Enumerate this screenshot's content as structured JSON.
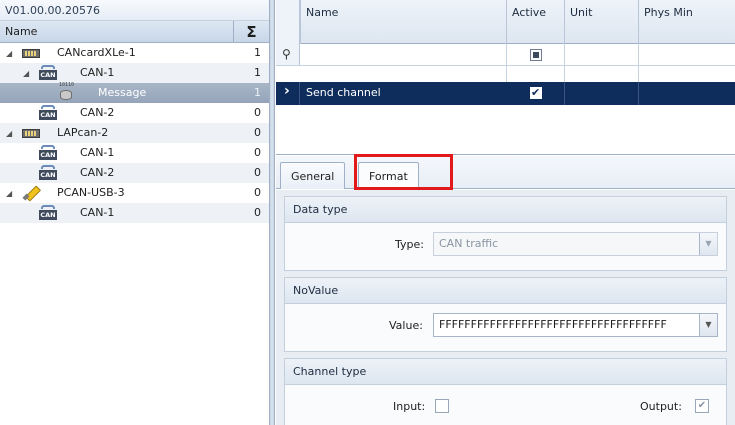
{
  "version": "V01.00.00.20576",
  "tree": {
    "header_name": "Name",
    "header_sum": "Σ",
    "items": [
      {
        "label": "CANcardXLe-1",
        "count": "1"
      },
      {
        "label": "CAN-1",
        "count": "1"
      },
      {
        "label": "Message",
        "count": "1"
      },
      {
        "label": "CAN-2",
        "count": "0"
      },
      {
        "label": "LAPcan-2",
        "count": "0"
      },
      {
        "label": "CAN-1",
        "count": "0"
      },
      {
        "label": "CAN-2",
        "count": "0"
      },
      {
        "label": "PCAN-USB-3",
        "count": "0"
      },
      {
        "label": "CAN-1",
        "count": "0"
      }
    ]
  },
  "grid": {
    "columns": [
      "Name",
      "Active",
      "Unit",
      "Phys Min"
    ],
    "rows": [
      {
        "name": "Send channel",
        "active": true
      }
    ]
  },
  "tabs": [
    "General",
    "Format"
  ],
  "active_tab": "Format",
  "form": {
    "data_type": {
      "title": "Data type",
      "label": "Type:",
      "value": "CAN traffic"
    },
    "no_value": {
      "title": "NoValue",
      "label": "Value:",
      "value": "FFFFFFFFFFFFFFFFFFFFFFFFFFFFFFFFFFFF"
    },
    "channel_type": {
      "title": "Channel type",
      "input_label": "Input:",
      "input_checked": false,
      "output_label": "Output:",
      "output_checked": true
    }
  },
  "icons": {
    "glyphs": {
      "filter": "⚲",
      "expand": "◢",
      "arrow": "›",
      "check": "✔",
      "dropdown": "▼"
    }
  },
  "colors": {
    "selection": "#0f2d5c",
    "highlight": "#e2191b"
  }
}
